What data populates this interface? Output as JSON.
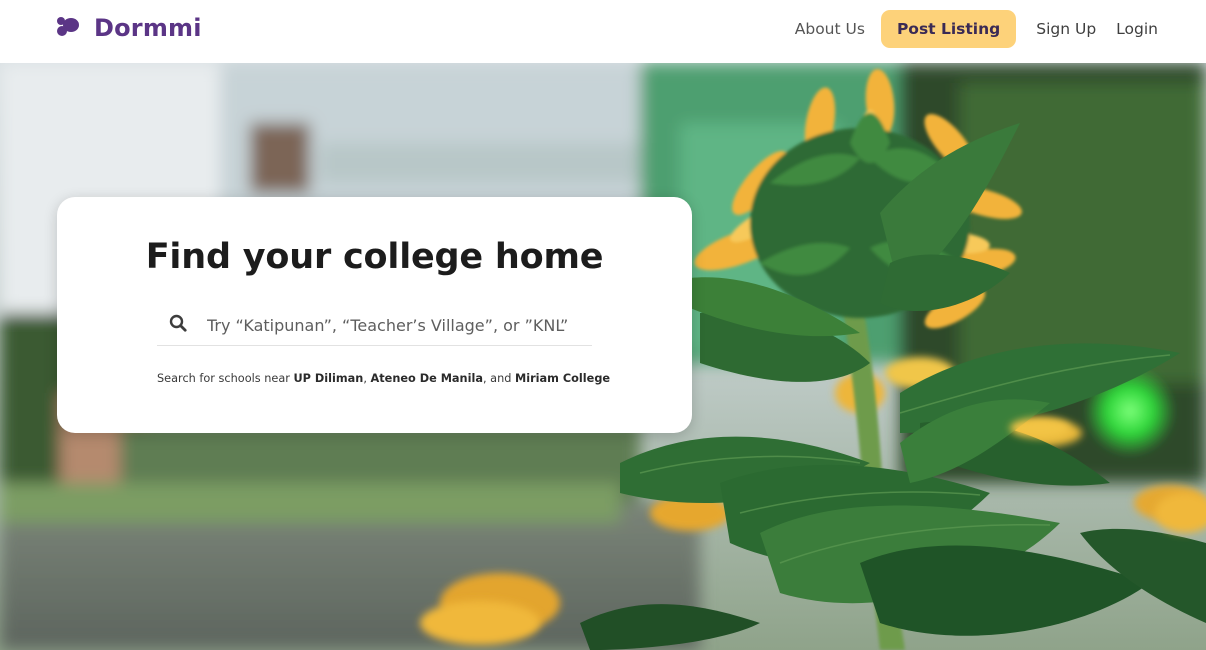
{
  "brand": {
    "name": "Dormmi",
    "logo_icon": "blob-logo-icon",
    "color": "#5b3586"
  },
  "nav": {
    "about": "About Us",
    "post_listing": "Post Listing",
    "sign_up": "Sign Up",
    "login": "Login",
    "accent": "#fdd27a"
  },
  "hero": {
    "background": "sunflower-photo",
    "card": {
      "title": "Find your college home",
      "search_placeholder": "Try “Katipunan”, “Teacher’s Village”, or ”KNL”",
      "search_icon": "search-icon",
      "hint_prefix": "Search for schools near ",
      "schools": [
        "UP Diliman",
        "Ateneo De Manila",
        "Miriam College"
      ],
      "hint_sep1": ", ",
      "hint_sep2": ", and "
    }
  }
}
